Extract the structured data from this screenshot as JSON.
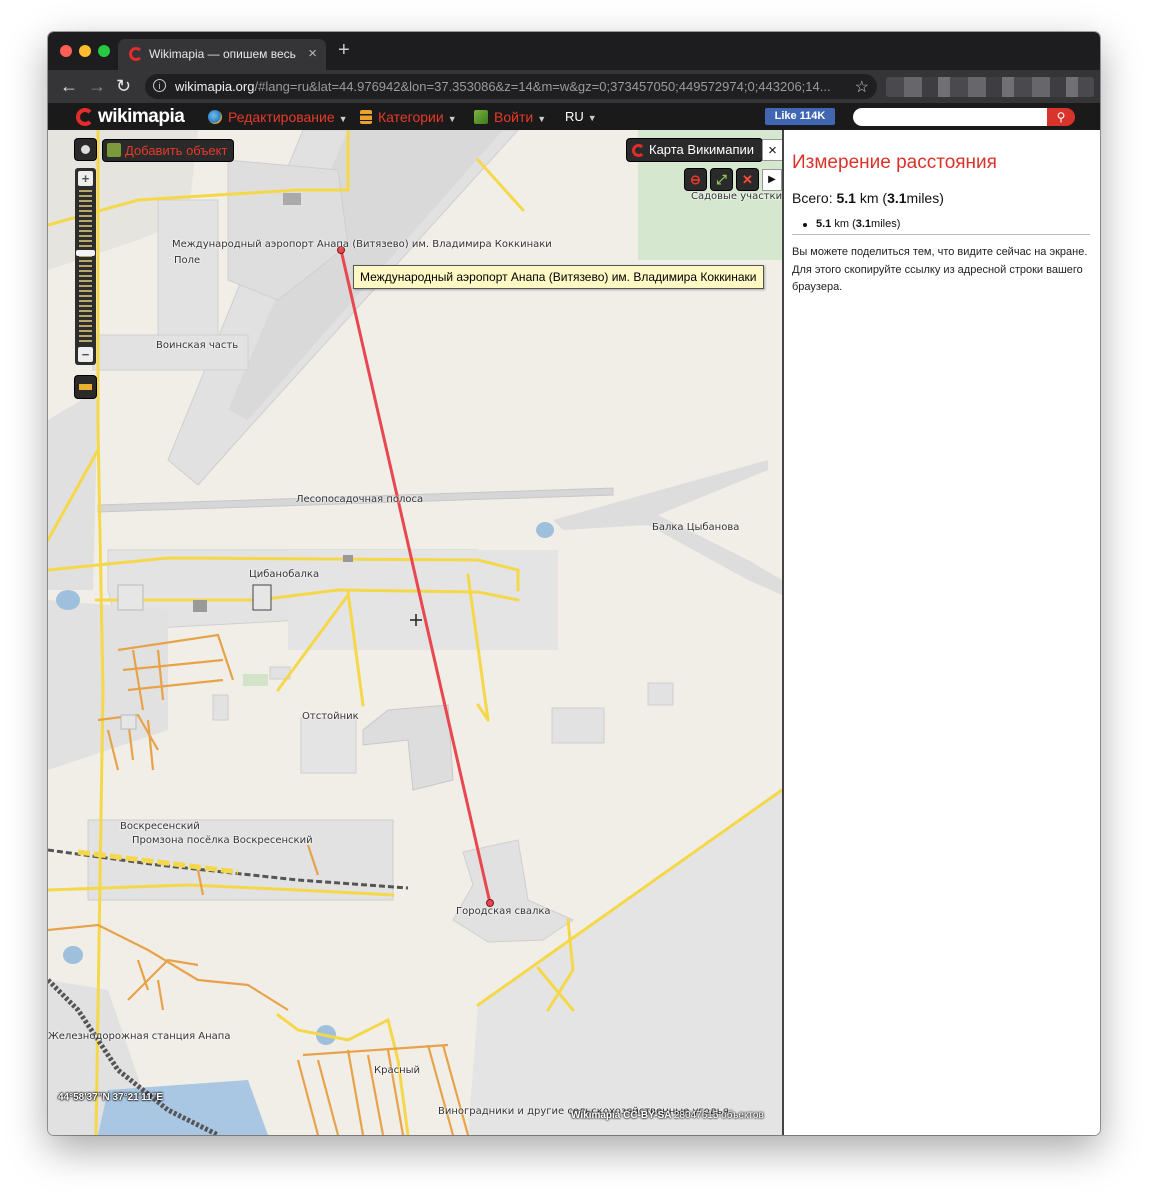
{
  "browser": {
    "tab_title": "Wikimapia — опишем весь мир!",
    "tab_close": "×",
    "new_tab": "+",
    "url_host": "wikimapia.org",
    "url_rest": "/#lang=ru&lat=44.976942&lon=37.353086&z=14&m=w&gz=0;373457050;449572974;0;443206;14...",
    "back": "←",
    "forward": "→",
    "reload": "↻",
    "star": "☆",
    "info": "i"
  },
  "site": {
    "logo": "wikimapia",
    "menu": {
      "edit": "Редактирование",
      "categories": "Категории",
      "login": "Войти",
      "lang": "RU"
    },
    "fb_like": "Like 114K",
    "search_placeholder": "",
    "search_icon": "magnifier-icon"
  },
  "map": {
    "add_object": "Добавить объект",
    "layer": "Карта Викимапии",
    "close": "×",
    "tooltip": "Международный аэропорт Анапа (Витязево) им. Владимира Коккинаки",
    "zoom_in": "+",
    "zoom_out": "−",
    "tools": {
      "minus": "⊖",
      "expand": "⤢",
      "delete": "✕",
      "toggle": "▶"
    },
    "labels": {
      "airport": "Международный аэропорт Анапа (Витязево) им. Владимира Коккинаки",
      "field": "Поле",
      "military": "Воинская часть",
      "gardens": "Садовые участки",
      "forest_strip": "Лесопосадочная полоса",
      "balka": "Балка Цыбанова",
      "village": "Цибанобалка",
      "settling": "Отстойник",
      "voskresensky": "Воскресенский",
      "promzona": "Промзона посёлка Воскресенский",
      "dump": "Городская свалка",
      "station": "Железнодорожная станция Анапа",
      "krasny": "Красный",
      "vineyards": "Виноградники и другие сельскохозяйственные угодья"
    },
    "coordinates": "44°58'37\"N 37°21'11\"E",
    "license": "Wikimapia CC-BY-SA",
    "objects_count": "28047615 объектов"
  },
  "panel": {
    "title": "Измерение расстояния",
    "total_label": "Всего: ",
    "total_km": "5.1",
    "km_unit": " km (",
    "total_miles": "3.1",
    "miles_unit": "miles)",
    "segment_km": "5.1",
    "segment_km_unit": " km (",
    "segment_miles": "3.1",
    "segment_miles_unit": "miles)",
    "note": "Вы можете поделиться тем, что видите сейчас на экране. Для этого скопируйте ссылку из адресной строки вашего браузера."
  },
  "colors": {
    "accent": "#e32c2c",
    "measure_line": "#e8474f",
    "road": "#f5d84a",
    "road_orange": "#e8a24a",
    "area_gray": "#dcdcdc",
    "water": "#9ec0dd"
  }
}
